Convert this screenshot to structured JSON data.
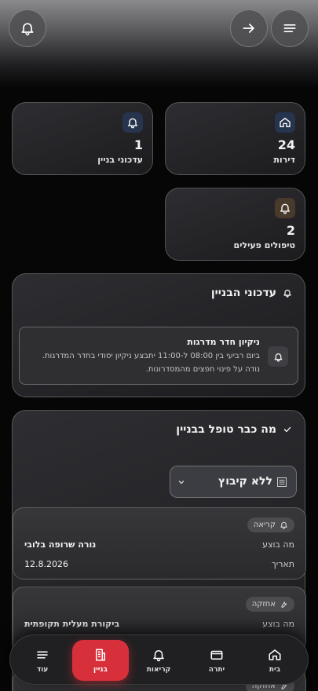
{
  "header": {
    "notifications_icon": "bell-icon",
    "forward_icon": "arrow-right-icon",
    "menu_icon": "menu-icon"
  },
  "stats": [
    {
      "value": "24",
      "label": "דירות",
      "icon": "home-icon",
      "accent": "#27344d"
    },
    {
      "value": "1",
      "label": "עדכוני בניין",
      "icon": "bell-icon",
      "accent": "#27344d"
    },
    {
      "value": "2",
      "label": "טיפולים פעילים",
      "icon": "bell-icon",
      "accent": "#4a3a2c"
    }
  ],
  "updates": {
    "title": "עדכוני הבניין",
    "items": [
      {
        "title": "ניקיון חדר מדרגות",
        "body": "ביום רביעי בין 08:00 ל-11:00 יתבצע ניקיון יסודי בחדר המדרגות. נודה על פינוי חפצים מהמסדרונות."
      }
    ]
  },
  "handled": {
    "title": "מה כבר טופל בבניין",
    "group_select": "ללא קיבוץ",
    "items": [
      {
        "badge": "קריאה",
        "what_label": "מה בוצע",
        "what": "נורה שרופה בלובי",
        "date_label": "תאריך",
        "date": "12.8.2026"
      },
      {
        "badge": "אחזקה",
        "what_label": "מה בוצע",
        "what": "ביקורת מעלית תקופתית"
      },
      {
        "badge": "אחזקה"
      }
    ]
  },
  "nav": [
    {
      "label": "בית",
      "icon": "home-icon"
    },
    {
      "label": "יתרה",
      "icon": "wallet-icon"
    },
    {
      "label": "קריאות",
      "icon": "bell-icon"
    },
    {
      "label": "בניין",
      "icon": "building-icon",
      "active": true
    },
    {
      "label": "עוד",
      "icon": "menu-icon"
    }
  ],
  "colors": {
    "accent": "#d8303a",
    "background": "#060607"
  }
}
